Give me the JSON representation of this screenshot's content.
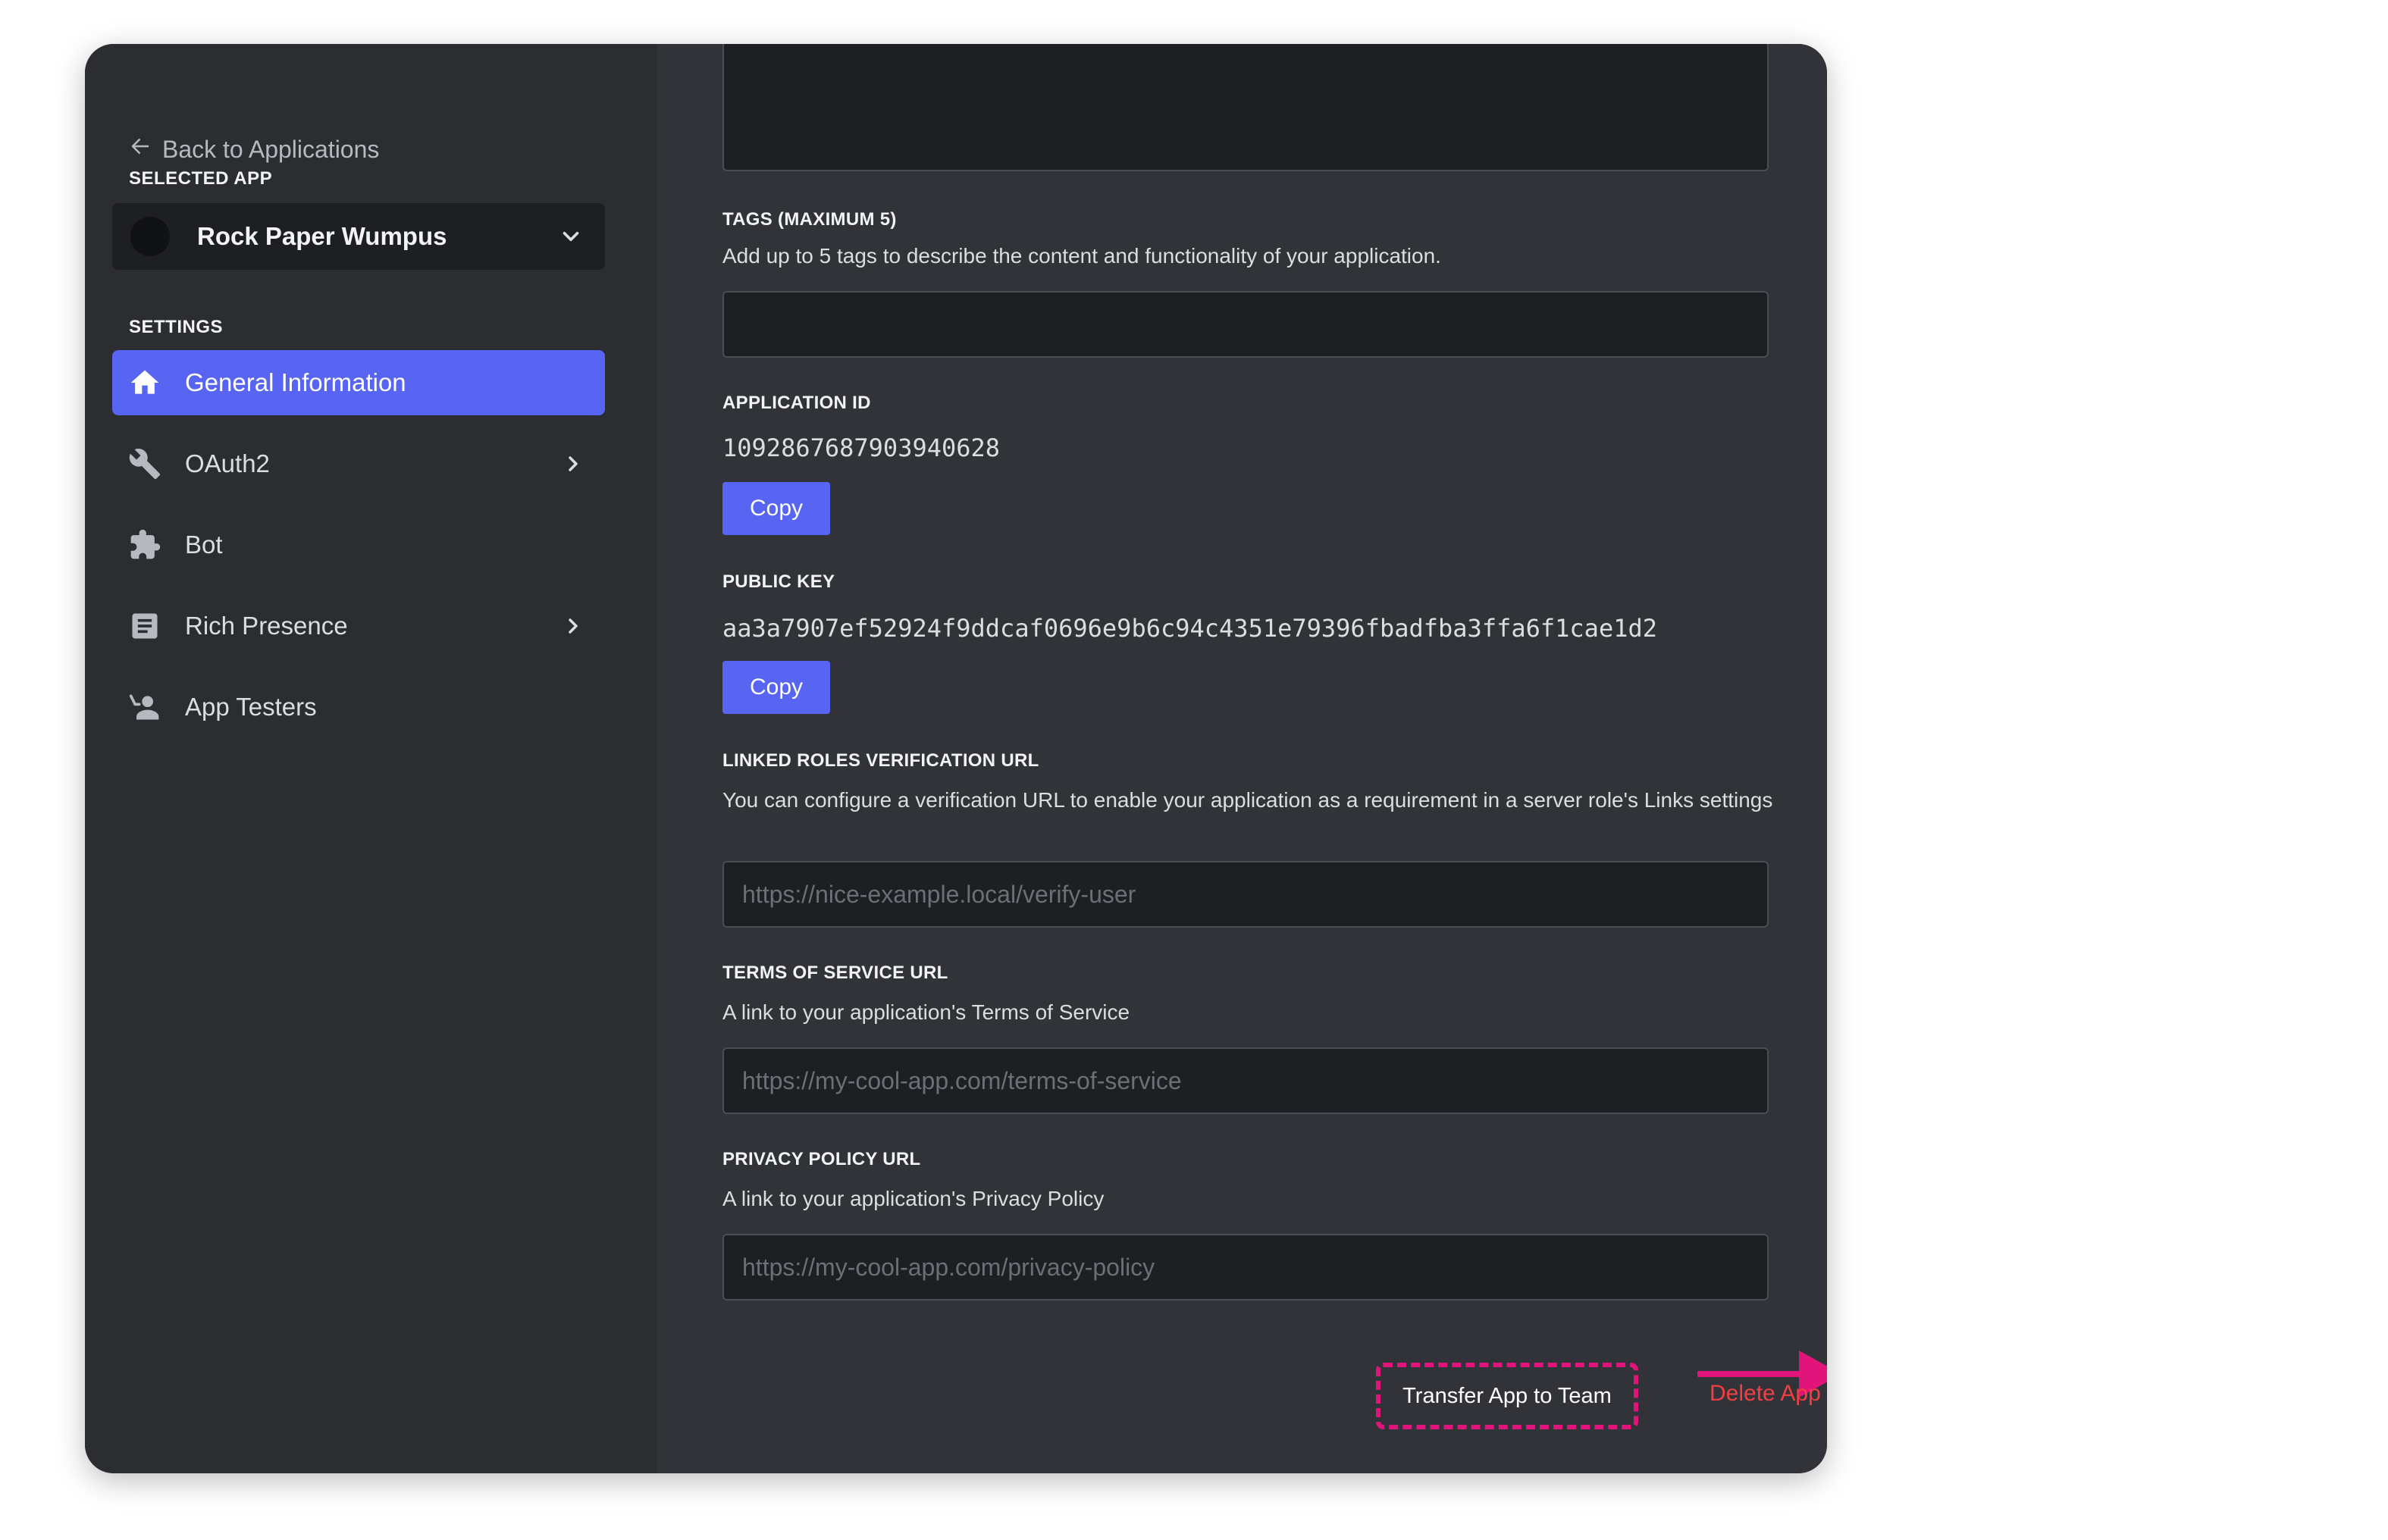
{
  "sidebar": {
    "back_label": "Back to Applications",
    "selected_app_heading": "SELECTED APP",
    "selected_app_name": "Rock Paper Wumpus",
    "settings_heading": "SETTINGS",
    "items": [
      {
        "label": "General Information",
        "icon": "home-icon",
        "active": true
      },
      {
        "label": "OAuth2",
        "icon": "wrench-icon",
        "has_chevron": true
      },
      {
        "label": "Bot",
        "icon": "puzzle-icon"
      },
      {
        "label": "Rich Presence",
        "icon": "document-icon",
        "has_chevron": true
      },
      {
        "label": "App Testers",
        "icon": "person-icon"
      }
    ]
  },
  "main": {
    "tags": {
      "label": "TAGS (MAXIMUM 5)",
      "description": "Add up to 5 tags to describe the content and functionality of your application.",
      "value": ""
    },
    "application_id": {
      "label": "APPLICATION ID",
      "value": "1092867687903940628",
      "copy_label": "Copy"
    },
    "public_key": {
      "label": "PUBLIC KEY",
      "value": "aa3a7907ef52924f9ddcaf0696e9b6c94c4351e79396fbadfba3ffa6f1cae1d2",
      "copy_label": "Copy"
    },
    "linked_roles": {
      "label": "LINKED ROLES VERIFICATION URL",
      "description": "You can configure a verification URL to enable your application as a requirement in a server role's Links settings",
      "placeholder": "https://nice-example.local/verify-user"
    },
    "terms": {
      "label": "TERMS OF SERVICE URL",
      "description": "A link to your application's Terms of Service",
      "placeholder": "https://my-cool-app.com/terms-of-service"
    },
    "privacy": {
      "label": "PRIVACY POLICY URL",
      "description": "A link to your application's Privacy Policy",
      "placeholder": "https://my-cool-app.com/privacy-policy"
    },
    "transfer_label": "Transfer App to Team",
    "delete_label": "Delete App"
  },
  "colors": {
    "accent": "#5865f2",
    "annotation": "#e0147b",
    "danger": "#f23f43"
  }
}
